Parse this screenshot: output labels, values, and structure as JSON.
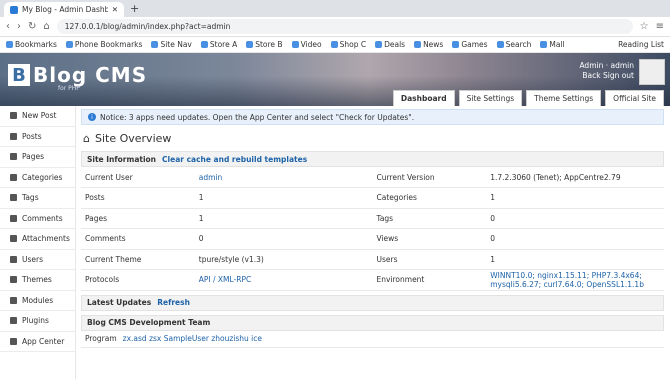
{
  "browser": {
    "tab_title": "My Blog - Admin Dashboard",
    "url": "127.0.0.1/blog/admin/index.php?act=admin",
    "bookmarks": [
      "Bookmarks",
      "Phone Bookmarks",
      "Site Nav",
      "Store A",
      "Store B",
      "Video",
      "Shop C",
      "Deals",
      "News",
      "Games",
      "Search",
      "Mall"
    ],
    "bookmarks_right": "Reading List"
  },
  "header": {
    "logo_word": "Blog CMS",
    "logo_sub": "for PHP",
    "user_line1": "Admin · admin",
    "user_return": "Back",
    "user_logout": "Sign out",
    "tabs": [
      "Dashboard",
      "Site Settings",
      "Theme Settings",
      "Official Site"
    ]
  },
  "sidebar": {
    "items": [
      "New Post",
      "Posts",
      "Pages",
      "Categories",
      "Tags",
      "Comments",
      "Attachments",
      "Users",
      "Themes",
      "Modules",
      "Plugins",
      "App Center"
    ]
  },
  "notice": "Notice: 3 apps need updates. Open the App Center and select \"Check for Updates\".",
  "page_title": "Site Overview",
  "site_info": {
    "heading": "Site Information",
    "action": "Clear cache and rebuild templates",
    "rows": [
      [
        "Current User",
        "admin",
        "Current Version",
        "1.7.2.3060 (Tenet); AppCentre2.79"
      ],
      [
        "Posts",
        "1",
        "Categories",
        "1"
      ],
      [
        "Pages",
        "1",
        "Tags",
        "0"
      ],
      [
        "Comments",
        "0",
        "Views",
        "0"
      ],
      [
        "Current Theme",
        "tpure/style (v1.3)",
        "Users",
        "1"
      ],
      [
        "Protocols",
        "API / XML-RPC",
        "Environment",
        "WINNT10.0; nginx1.15.11; PHP7.3.4x64; mysqli5.6.27; curl7.64.0; OpenSSL1.1.1b"
      ]
    ]
  },
  "updates": {
    "heading": "Latest Updates",
    "action": "Refresh"
  },
  "dev": {
    "heading": "Blog CMS Development Team",
    "row_label": "Program",
    "row_value": "zx.asd zsx SampleUser zhouzishu ice"
  },
  "colors": {
    "link": "#1d62a8",
    "accent": "#2a7bd5"
  }
}
